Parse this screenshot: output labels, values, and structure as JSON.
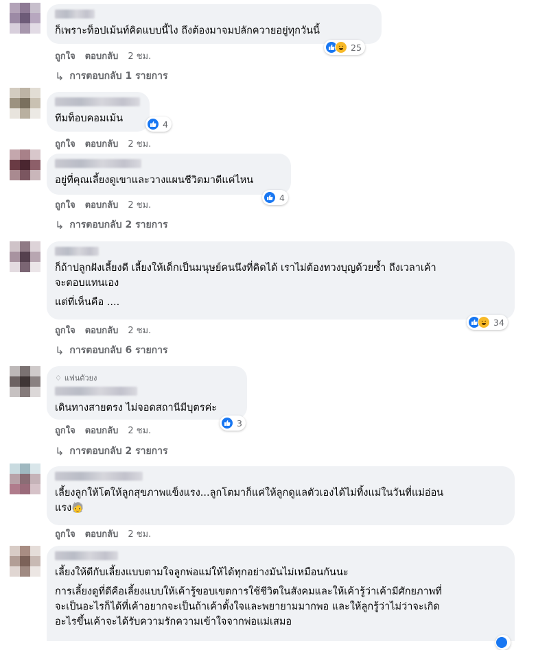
{
  "actions": {
    "like": "ถูกใจ",
    "reply": "ตอบกลับ"
  },
  "icons": {
    "like": "thumbs-up-icon",
    "haha": "laughing-face-icon",
    "reply_arrow": "reply-arrow-icon",
    "fan_badge": "diamond-icon",
    "emoji": "face-with-hat-emoji-icon"
  },
  "colors": {
    "bubble": "#f0f2f5",
    "like_blue": "#1877f2",
    "haha_yellow": "#f7b928",
    "meta_gray": "#65676b"
  },
  "comments": [
    {
      "text": "ก็เพราะท็อปเม้นท์คิดแบบนี้ไง ถึงต้องมาจมปลักควายอยู่ทุกวันนี้",
      "time": "2 ชม.",
      "reactions": "25",
      "replies": "การตอบกลับ 1 รายการ"
    },
    {
      "text": "ทีมท็อบคอมเม้น",
      "time": "2 ชม.",
      "reactions": "4"
    },
    {
      "text": "อยู่ที่คุณเลี้ยงดูเขาและวางแผนชีวิตมาดีแค่ไหน",
      "time": "2 ชม.",
      "reactions": "4",
      "replies": "การตอบกลับ 2 รายการ"
    },
    {
      "text1": "ก็ถ้าปลูกฝังเลี้ยงดี เลี้ยงให้เด็กเป็นมนุษย์คนนึงที่คิดได้ เราไม่ต้องทวงบุญด้วยซ้ำ ถึงเวลาเค้า\nจะตอบแทนเอง",
      "text2": "แต่ที่เห็นคือ ....",
      "time": "2 ชม.",
      "reactions": "34",
      "replies": "การตอบกลับ 6 รายการ"
    },
    {
      "badge": "แฟนตัวยง",
      "text": "เดินทางสายตรง ไม่จอดสถานีมีบุตรค่ะ",
      "time": "2 ชม.",
      "reactions": "3",
      "replies": "การตอบกลับ 2 รายการ"
    },
    {
      "text": "เลี้ยงลูกให้โตให้ลูกสุขภาพแข็งแรง...ลูกโตมาก็แค่ให้ลูกดูแลตัวเองได้ไม่ทิ้งแม่ในวันที่แม่อ่อน\nแรง",
      "emoji": "🧓",
      "time": "2 ชม."
    },
    {
      "text1": "เลี้ยงให้ดีกับเลี้ยงแบบตามใจลูกพ่อแม่ให้ได้ทุกอย่างมันไม่เหมือนกันนะ",
      "text2": "การเลี้ยงดูที่ดีคือเลี้ยงแบบให้เค้ารู้ขอบเขตการใช้ชีวิตในสังคมและให้เค้ารู้ว่าเค้ามีศักยภาพที่\nจะเป็นอะไรก็ได้ที่เค้าอยากจะเป็นถ้าเค้าตั้งใจและพยายามมากพอ และให้ลูกรู้ว่าไม่ว่าจะเกิด\nอะไรขึ้นเค้าจะได้รับความรักความเข้าใจจากพ่อแม่เสมอ"
    }
  ]
}
